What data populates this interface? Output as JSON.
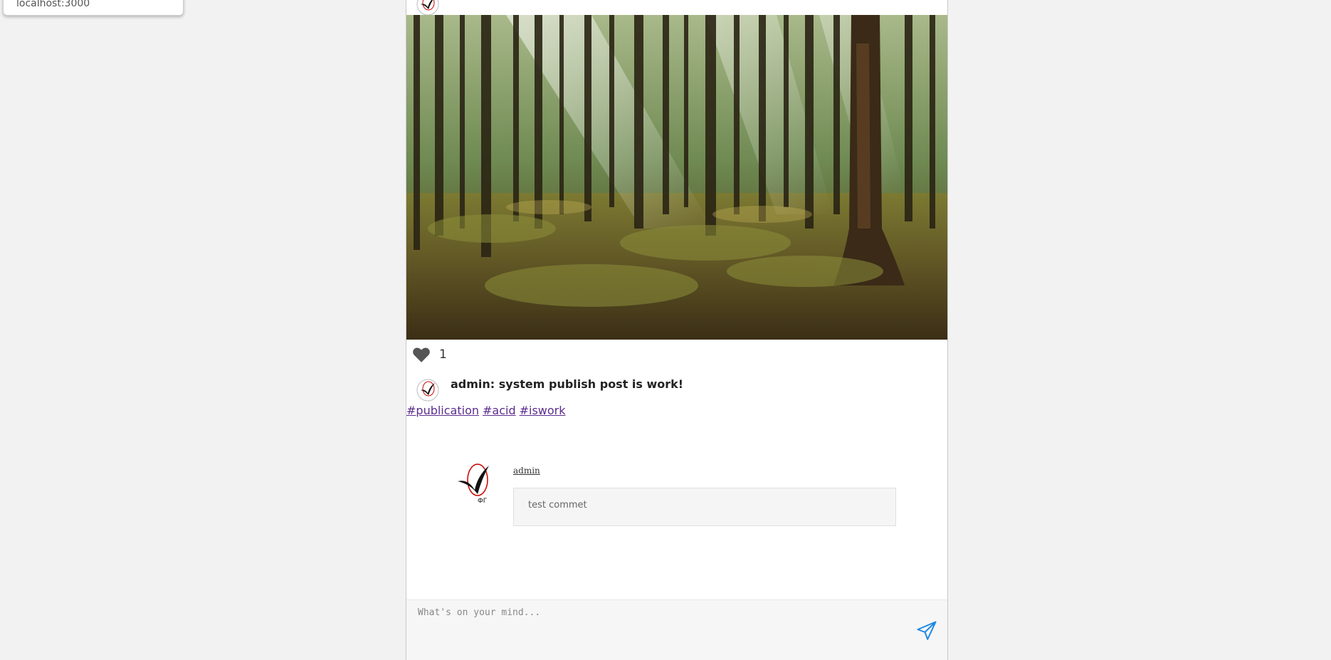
{
  "tooltip": {
    "text": "localhost:3000"
  },
  "post": {
    "likes": "1",
    "title": "admin: system publish post is work!",
    "tags": [
      "#publication",
      "#acid",
      "#iswork"
    ],
    "image_icon": "forest-photo"
  },
  "comment": {
    "author": "admin",
    "text": "test commet"
  },
  "composer": {
    "placeholder": "What's on your mind..."
  },
  "colors": {
    "tag": "#5b2d8e",
    "send": "#1e88e5",
    "heart": "#555555"
  }
}
